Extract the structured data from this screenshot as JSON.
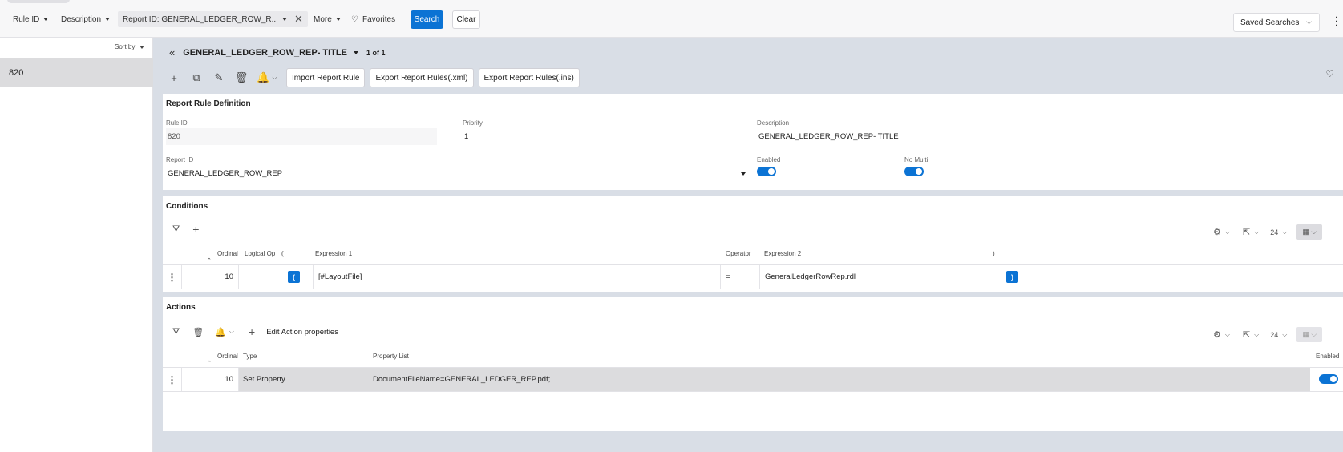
{
  "filters": {
    "rule_id": "Rule ID",
    "description": "Description",
    "report_id_chip": "Report ID: GENERAL_LEDGER_ROW_R...",
    "more": "More",
    "favorites": "Favorites",
    "search": "Search",
    "clear": "Clear",
    "saved_searches": "Saved Searches"
  },
  "left": {
    "sort_by": "Sort by",
    "items": [
      "820"
    ]
  },
  "record": {
    "title": "GENERAL_LEDGER_ROW_REP- TITLE",
    "count": "1 of 1"
  },
  "toolbar": {
    "import": "Import Report Rule",
    "export_xml": "Export Report Rules(.xml)",
    "export_ins": "Export Report Rules(.ins)"
  },
  "definition": {
    "title": "Report Rule Definition",
    "rule_id_label": "Rule ID",
    "rule_id": "820",
    "priority_label": "Priority",
    "priority": "1",
    "description_label": "Description",
    "description": "GENERAL_LEDGER_ROW_REP- TITLE",
    "report_id_label": "Report ID",
    "report_id": "GENERAL_LEDGER_ROW_REP",
    "enabled_label": "Enabled",
    "enabled": true,
    "no_multi_label": "No Multi",
    "no_multi": true
  },
  "conditions": {
    "title": "Conditions",
    "page_size": "24",
    "headers": {
      "ordinal": "Ordinal",
      "logical_op": "Logical Op",
      "open": "(",
      "expr1": "Expression 1",
      "operator": "Operator",
      "expr2": "Expression 2",
      "close": ")"
    },
    "rows": [
      {
        "ordinal": "10",
        "logical_op": "",
        "open": "(",
        "expr1": "[#LayoutFile]",
        "operator": "=",
        "expr2": "GeneralLedgerRowRep.rdl",
        "close": ")"
      }
    ]
  },
  "actions": {
    "title": "Actions",
    "edit_props": "Edit Action properties",
    "page_size": "24",
    "headers": {
      "ordinal": "Ordinal",
      "type": "Type",
      "property_list": "Property List",
      "enabled": "Enabled"
    },
    "rows": [
      {
        "ordinal": "10",
        "type": "Set Property",
        "property_list": "DocumentFileName=GENERAL_LEDGER_REP.pdf;",
        "enabled": true
      }
    ]
  },
  "colors": {
    "accent": "#0b73d4",
    "main_bg": "#d9dee6",
    "selected_row": "#dcdcde"
  }
}
